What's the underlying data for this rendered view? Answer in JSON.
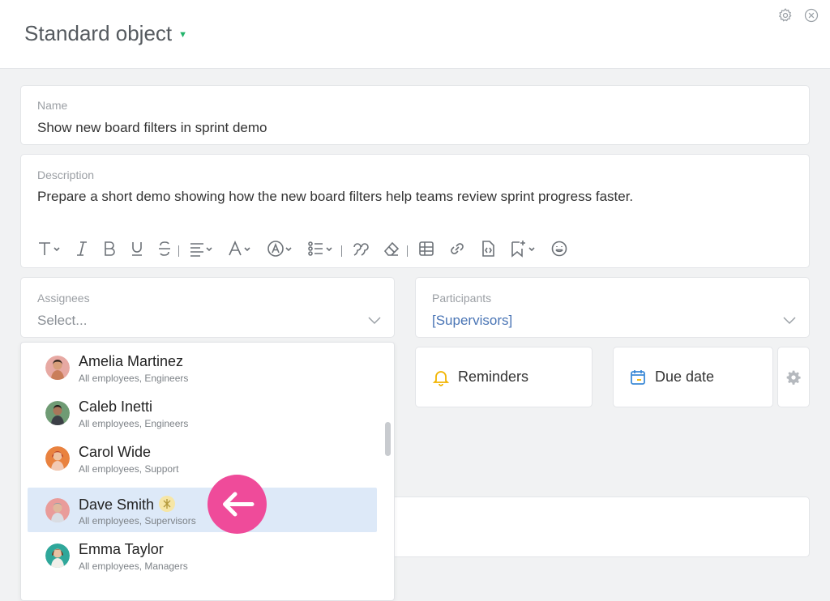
{
  "header": {
    "title": "Standard object",
    "icons": [
      "gear-icon",
      "close-circle-icon"
    ]
  },
  "name_field": {
    "label": "Name",
    "value": "Show new board filters in sprint demo"
  },
  "description_field": {
    "label": "Description",
    "value": "Prepare a short demo showing how the new board filters help teams review sprint progress faster.",
    "toolbar": [
      "text-style-icon",
      "italic-icon",
      "bold-icon",
      "underline-icon",
      "strikethrough-icon",
      "align-icon",
      "font-color-icon",
      "highlight-icon",
      "list-icon",
      "quote-icon",
      "eraser-icon",
      "table-icon",
      "link-icon",
      "code-icon",
      "bookmark-add-icon",
      "emoji-icon"
    ]
  },
  "assignees": {
    "label": "Assignees",
    "placeholder": "Select..."
  },
  "participants": {
    "label": "Participants",
    "value": "[Supervisors]"
  },
  "buttons": {
    "reminders": "Reminders",
    "due_date": "Due date"
  },
  "dropdown": {
    "options": [
      {
        "name": "Amelia Martinez",
        "groups": "All employees, Engineers",
        "selected": false
      },
      {
        "name": "Caleb Inetti",
        "groups": "All employees, Engineers",
        "selected": false
      },
      {
        "name": "Carol Wide",
        "groups": "All employees, Support",
        "selected": false
      },
      {
        "name": "Dave Smith",
        "groups": "All employees, Supervisors",
        "selected": true
      },
      {
        "name": "Emma Taylor",
        "groups": "All employees, Managers",
        "selected": false
      }
    ]
  },
  "colors": {
    "accent_green": "#23b46b",
    "link_blue": "#4a75b5",
    "selected_row": "#dde9f8",
    "pointer_pink": "#ef4b9a",
    "reminder_yellow": "#f2b400",
    "due_date_blue": "#3d8ad6"
  }
}
